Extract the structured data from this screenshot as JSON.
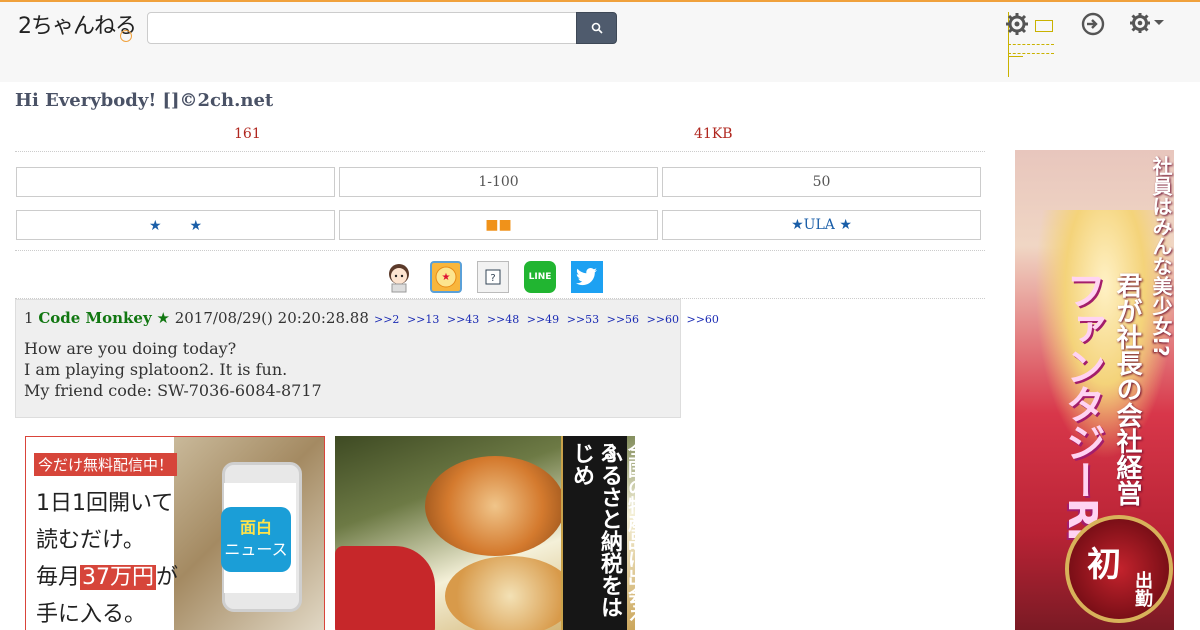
{
  "header": {
    "logo_text": "2ちゃんねる",
    "search_value": "",
    "search_icon": "search-icon",
    "icons": [
      "gear-icon",
      "login-icon",
      "settings-gear-icon"
    ]
  },
  "thread": {
    "title": "Hi Everybody! []©2ch.net",
    "post_count": "161",
    "size": "41KB"
  },
  "nav": {
    "row1": [
      "",
      "1-100",
      "50"
    ],
    "row2": [
      "★　　★",
      "■■",
      "★ULA ★"
    ]
  },
  "share_icons": [
    "mascot-icon",
    "app-icon",
    "help-icon",
    "line-icon",
    "twitter-icon"
  ],
  "share": {
    "line_label": "LINE"
  },
  "post": {
    "number": "1",
    "name": "Code Monkey",
    "star": "★",
    "date": "2017/08/29() 20:20:28.88",
    "refs": [
      ">>2",
      ">>13",
      ">>43",
      ">>48",
      ">>49",
      ">>53",
      ">>56",
      ">>60",
      ">>60"
    ],
    "lines": [
      "How are you doing today?",
      "I am playing splatoon2. It is fun.",
      "My friend code: SW-7036-6084-8717"
    ]
  },
  "ads": {
    "ad1": {
      "banner": "今だけ無料配信中！",
      "line1": "1日1回開いて",
      "line2": "読むだけ。",
      "line3_pre": "毎月",
      "line3_hl": "37万円",
      "line3_post": "が",
      "line4": "手に入る。",
      "app_top": "面白",
      "app_bottom": "ニュース"
    },
    "ad2": {
      "col1": "全国の特産品に出会える",
      "col2": "ふるさと納税をはじめ"
    },
    "ad3": {
      "t1": "社員はみんな美少女!?",
      "t2": "君が社長の会社経営",
      "t3": "ファンタジーRPG",
      "badge1": "初",
      "badge2": "出勤"
    }
  },
  "colors": {
    "accent_orange": "#f0a13c",
    "search_button": "#4f5b6d",
    "title": "#4a5266",
    "meta_red": "#b0271f",
    "name_green": "#117711",
    "ref_blue": "#1c2cb4"
  }
}
